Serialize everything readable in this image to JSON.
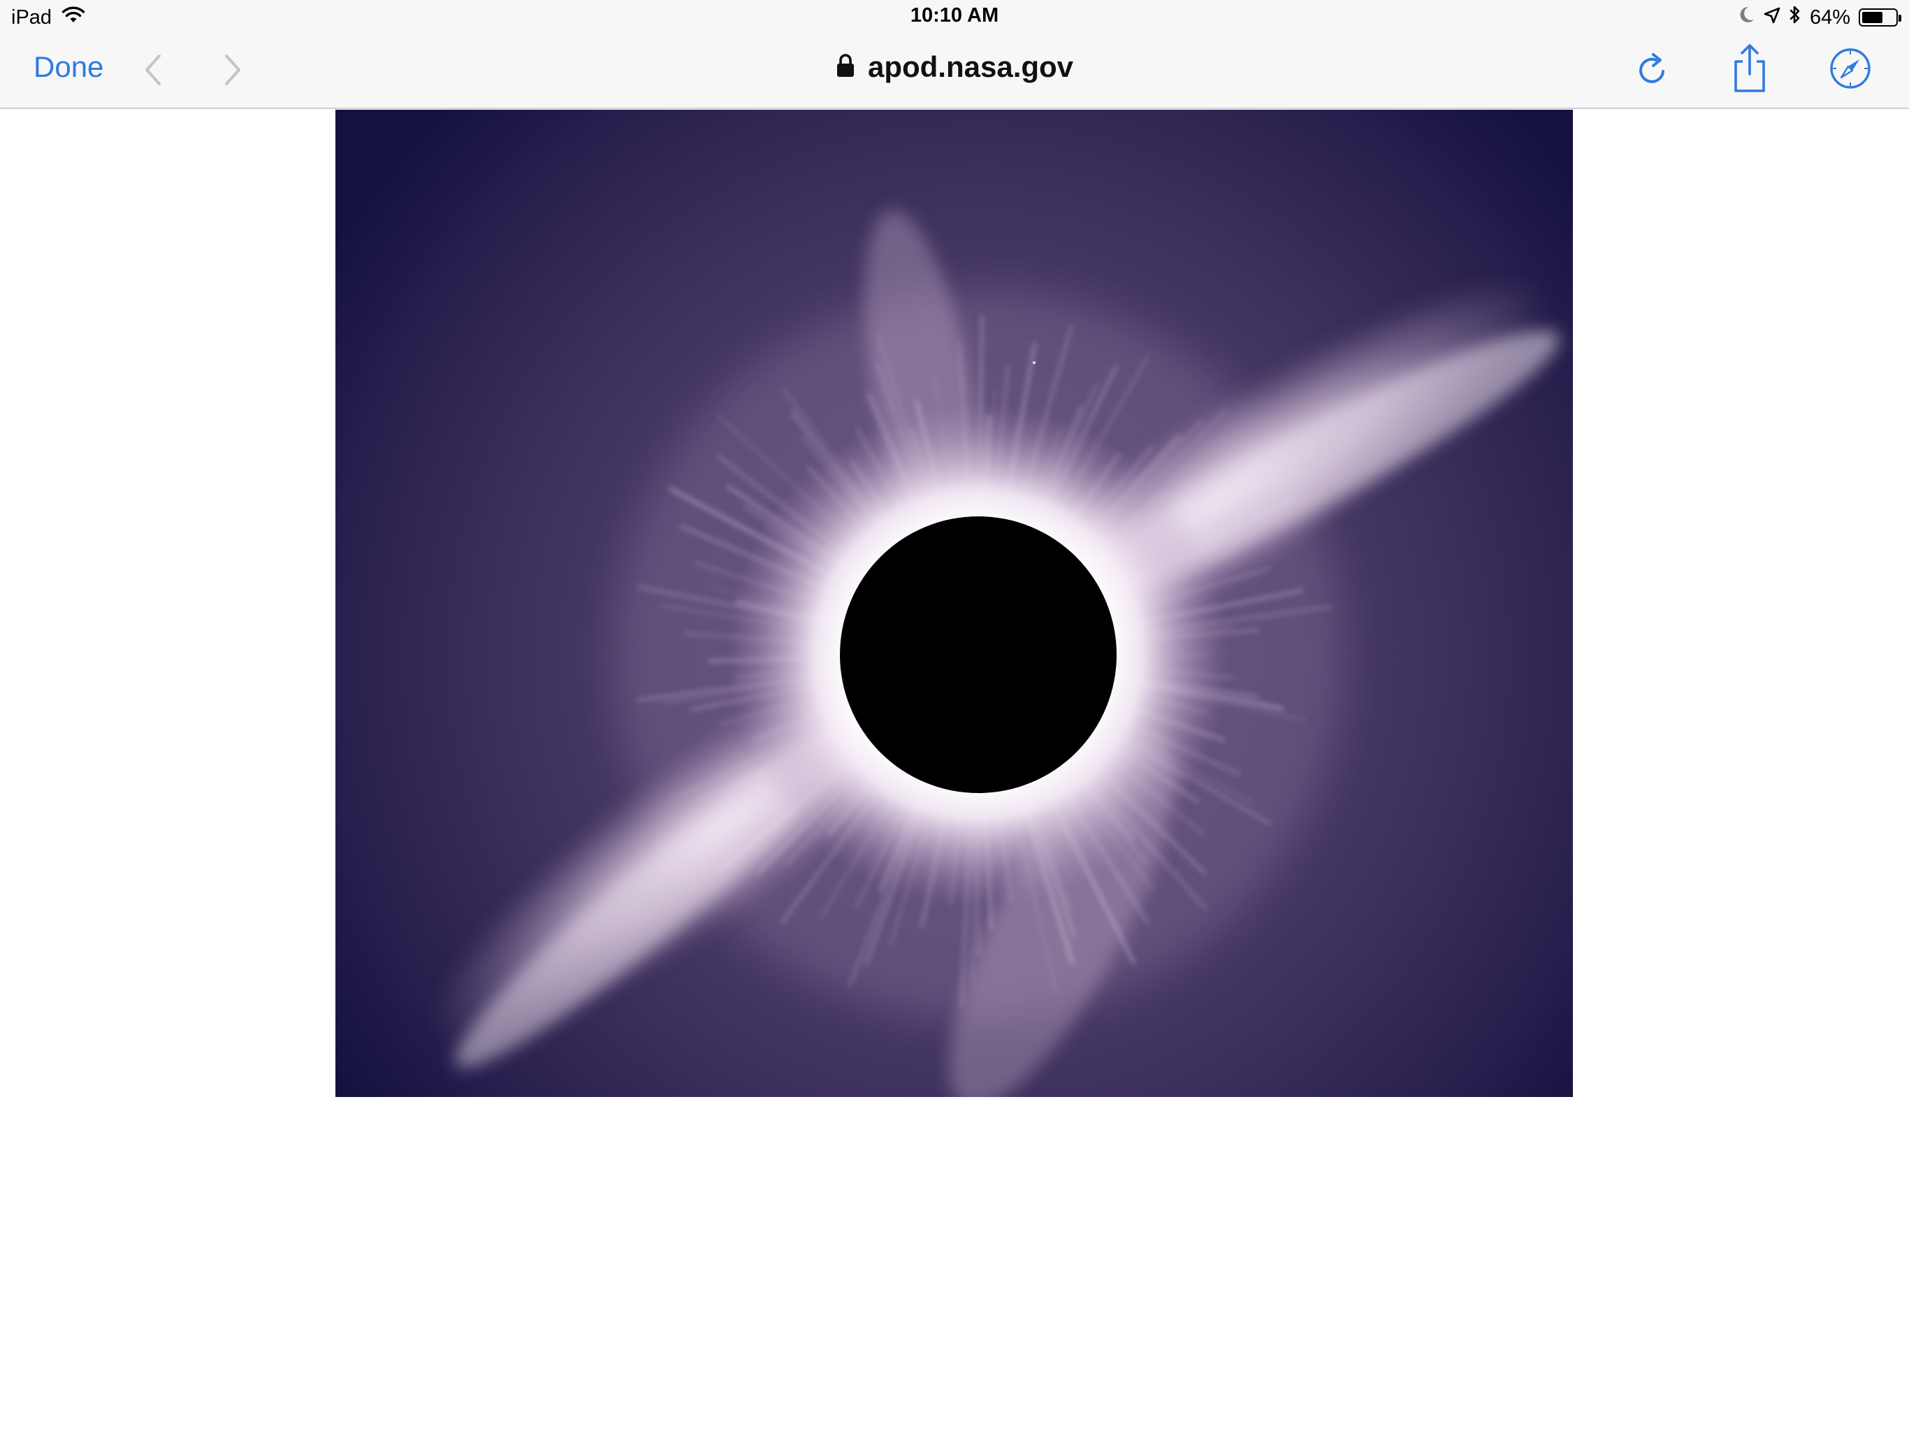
{
  "status_bar": {
    "device": "iPad",
    "time": "10:10 AM",
    "battery_percent_label": "64%",
    "battery_level": 0.64,
    "icons": [
      "wifi-icon",
      "moon-icon",
      "location-arrow-icon",
      "bluetooth-icon",
      "battery-icon"
    ]
  },
  "toolbar": {
    "done_label": "Done",
    "url": "apod.nasa.gov",
    "icons": [
      "back-chevron-icon",
      "forward-chevron-icon",
      "lock-icon",
      "reload-icon",
      "share-icon",
      "compass-icon"
    ],
    "accent_color": "#2f7bdf",
    "disabled_color": "#c4c4c8"
  },
  "content": {
    "image": "total-solar-eclipse-corona",
    "colors": {
      "sky_edge": "#141140",
      "sky_mid": "#4a3b67",
      "corona": "#f3e7f4",
      "moon": "#000000"
    }
  }
}
